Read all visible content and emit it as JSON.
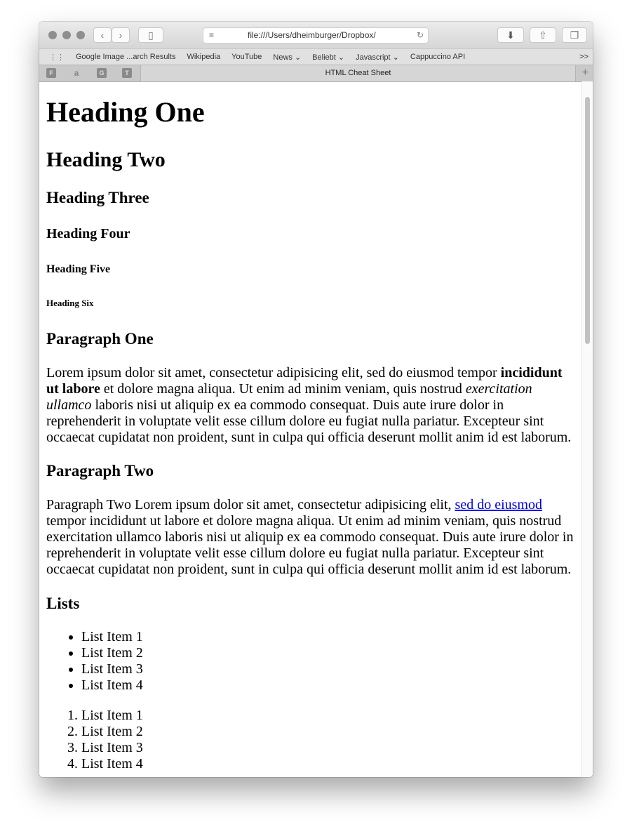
{
  "browser": {
    "url": "file:///Users/dheimburger/Dropbox/",
    "tab_title": "HTML Cheat Sheet",
    "bookmarks": [
      "Google Image ...arch Results",
      "Wikipedia",
      "YouTube",
      "News ⌄",
      "Beliebt ⌄",
      "Javascript ⌄",
      "Cappuccino API"
    ],
    "more": ">>",
    "pinned": [
      "F",
      "a",
      "G",
      "T"
    ]
  },
  "page": {
    "h1": "Heading One",
    "h2": "Heading Two",
    "h3": "Heading Three",
    "h4": "Heading Four",
    "h5": "Heading Five",
    "h6": "Heading Six",
    "p1_title": "Paragraph One",
    "p1": {
      "a": "Lorem ipsum dolor sit amet, consectetur adipisicing elit, sed do eiusmod tempor ",
      "bold": "incididunt ut labore",
      "b": " et dolore magna aliqua. Ut enim ad minim veniam, quis nostrud ",
      "italic": "exercitation ullamco",
      "c": " laboris nisi ut aliquip ex ea commodo consequat. Duis aute irure dolor in reprehenderit in voluptate velit esse cillum dolore eu fugiat nulla pariatur. Excepteur sint occaecat cupidatat non proident, sunt in culpa qui officia deserunt mollit anim id est laborum."
    },
    "p2_title": "Paragraph Two",
    "p2": {
      "a": "Paragraph Two Lorem ipsum dolor sit amet, consectetur adipisicing elit, ",
      "link": "sed do eiusmod",
      "b": " tempor incididunt ut labore et dolore magna aliqua. Ut enim ad minim veniam, quis nostrud exercitation ullamco laboris nisi ut aliquip ex ea commodo consequat. Duis aute irure dolor in reprehenderit in voluptate velit esse cillum dolore eu fugiat nulla pariatur. Excepteur sint occaecat cupidatat non proident, sunt in culpa qui officia deserunt mollit anim id est laborum."
    },
    "lists_title": "Lists",
    "ul": [
      "List Item 1",
      "List Item 2",
      "List Item 3",
      "List Item 4"
    ],
    "ol": [
      "List Item 1",
      "List Item 2",
      "List Item 3",
      "List Item 4"
    ]
  }
}
